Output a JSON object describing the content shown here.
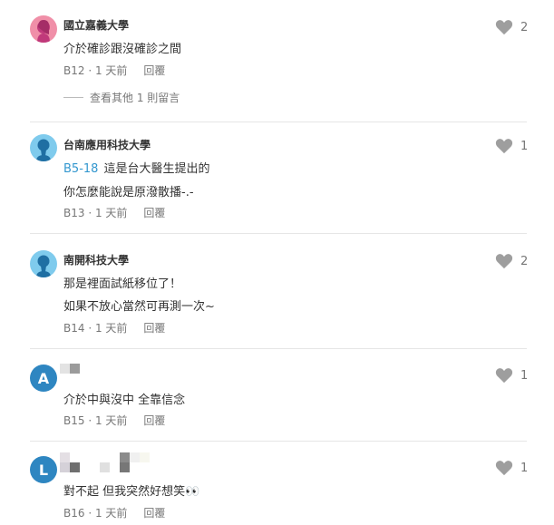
{
  "comments": [
    {
      "author": "國立嘉義大學",
      "lines": [
        "介於確診跟沒確診之間"
      ],
      "floor": "B12",
      "time": "1 天前",
      "reply": "回覆",
      "likes": "2",
      "more_replies": "查看其他 1 則留言"
    },
    {
      "author": "台南應用科技大學",
      "reply_ref": "B5-18",
      "lines": [
        "這是台大醫生提出的",
        "你怎麼能說是原潑散播-.-"
      ],
      "floor": "B13",
      "time": "1 天前",
      "reply": "回覆",
      "likes": "1"
    },
    {
      "author": "南開科技大學",
      "lines": [
        "那是裡面試紙移位了！",
        "如果不放心當然可再測一次~"
      ],
      "floor": "B14",
      "time": "1 天前",
      "reply": "回覆",
      "likes": "2"
    },
    {
      "avatar_letter": "A",
      "lines": [
        "介於中與沒中 全靠信念"
      ],
      "floor": "B15",
      "time": "1 天前",
      "reply": "回覆",
      "likes": "1"
    },
    {
      "avatar_letter": "L",
      "lines": [
        "對不起 但我突然好想笑👀"
      ],
      "floor": "B16",
      "time": "1 天前",
      "reply": "回覆",
      "likes": "1"
    }
  ],
  "meta_separator": " · ",
  "colors": {
    "accent": "#3397cf",
    "heart": "#9e9e9e",
    "divider": "#e6e6e6"
  }
}
